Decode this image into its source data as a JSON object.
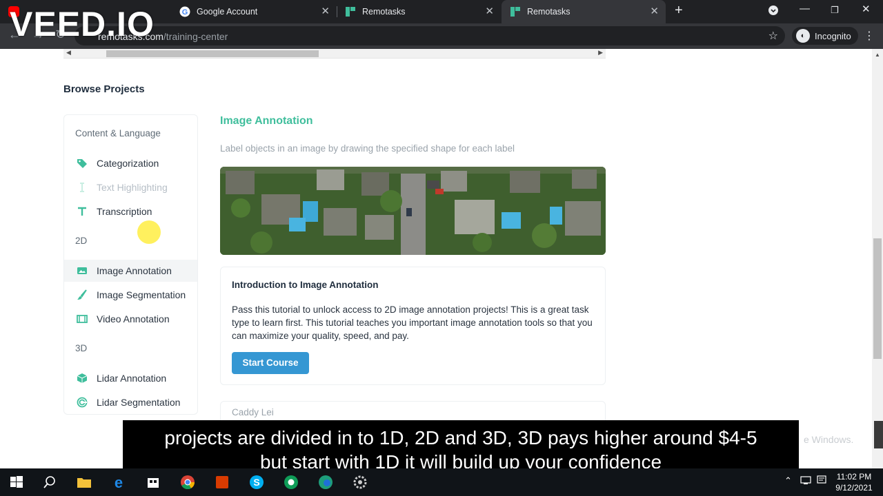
{
  "overlay": {
    "brand": "VEED.IO"
  },
  "browser": {
    "tabs": [
      {
        "title": "Google Account"
      },
      {
        "title": "Remotasks"
      },
      {
        "title": "Remotasks"
      }
    ],
    "url_host": "remotasks.com",
    "url_path": "/training-center",
    "profile_label": "Incognito"
  },
  "page": {
    "section_title": "Browse Projects",
    "sidebar": {
      "groups": [
        {
          "label": "Content & Language",
          "items": [
            {
              "label": "Categorization",
              "icon": "tag-icon"
            },
            {
              "label": "Text Highlighting",
              "icon": "text-cursor-icon",
              "disabled": true
            },
            {
              "label": "Transcription",
              "icon": "text-icon"
            }
          ]
        },
        {
          "label": "2D",
          "items": [
            {
              "label": "Image Annotation",
              "icon": "image-icon",
              "active": true
            },
            {
              "label": "Image Segmentation",
              "icon": "brush-icon"
            },
            {
              "label": "Video Annotation",
              "icon": "film-icon"
            }
          ]
        },
        {
          "label": "3D",
          "items": [
            {
              "label": "Lidar Annotation",
              "icon": "cube-icon"
            },
            {
              "label": "Lidar Segmentation",
              "icon": "radar-icon"
            }
          ]
        }
      ]
    },
    "main": {
      "title": "Image Annotation",
      "description": "Label objects in an image by drawing the specified shape for each label",
      "course": {
        "title": "Introduction to Image Annotation",
        "body": "Pass this tutorial to unlock access to 2D image annotation projects! This is a great task type to learn first. This tutorial teaches you important image annotation tools so that you can maximize your quality, speed, and pay.",
        "button": "Start Course"
      },
      "next_card_author": "Caddy Lei"
    },
    "watermark": "e Windows."
  },
  "caption": {
    "line1": "projects are divided in to 1D, 2D and 3D, 3D pays higher around $4-5",
    "line2": "but start with 1D it will build up your confidence"
  },
  "taskbar": {
    "time": "11:02 PM",
    "date": "9/12/2021"
  },
  "colors": {
    "accent_green": "#3fbe9c",
    "button_blue": "#3597d3"
  }
}
